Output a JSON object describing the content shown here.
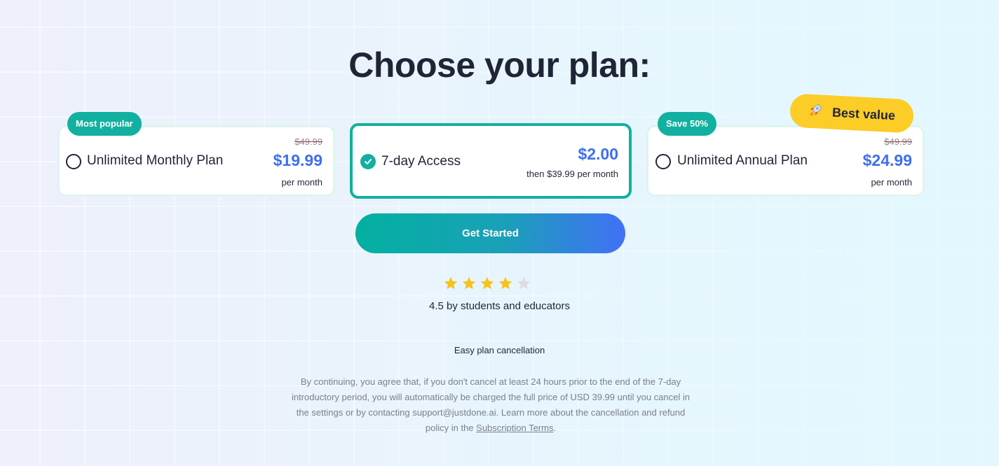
{
  "page": {
    "title": "Choose your plan:"
  },
  "plans": [
    {
      "badge": "Most popular",
      "name": "Unlimited Monthly Plan",
      "old_price": "$49.99",
      "price": "$19.99",
      "period": "per month",
      "selected": false
    },
    {
      "name": "7-day Access",
      "price": "$2.00",
      "period": "then $39.99 per month",
      "selected": true
    },
    {
      "badge": "Save 50%",
      "ribbon": "Best value",
      "ribbon_icon": "rocket-icon",
      "name": "Unlimited Annual Plan",
      "old_price": "$49.99",
      "price": "$24.99",
      "period": "per month",
      "selected": false
    }
  ],
  "cta": {
    "label": "Get Started"
  },
  "rating": {
    "value": 4.5,
    "filled_stars": 4,
    "total_stars": 5,
    "text": "4.5 by students and educators"
  },
  "cancellation": {
    "label": "Easy plan cancellation"
  },
  "legal": {
    "text": "By continuing, you agree that, if you don't cancel at least 24 hours prior to the end of the 7-day introductory period, you will automatically be charged the full price of USD 39.99 until you cancel in the settings or by contacting support@justdone.ai. Learn more about the cancellation and refund policy in the ",
    "link": "Subscription Terms",
    "end": "."
  },
  "colors": {
    "accent_teal": "#12b0a0",
    "price_blue": "#3f6ef0",
    "best_value_yellow": "#fccc27",
    "star_gold": "#f7c21a",
    "star_empty": "#dcdde2"
  }
}
